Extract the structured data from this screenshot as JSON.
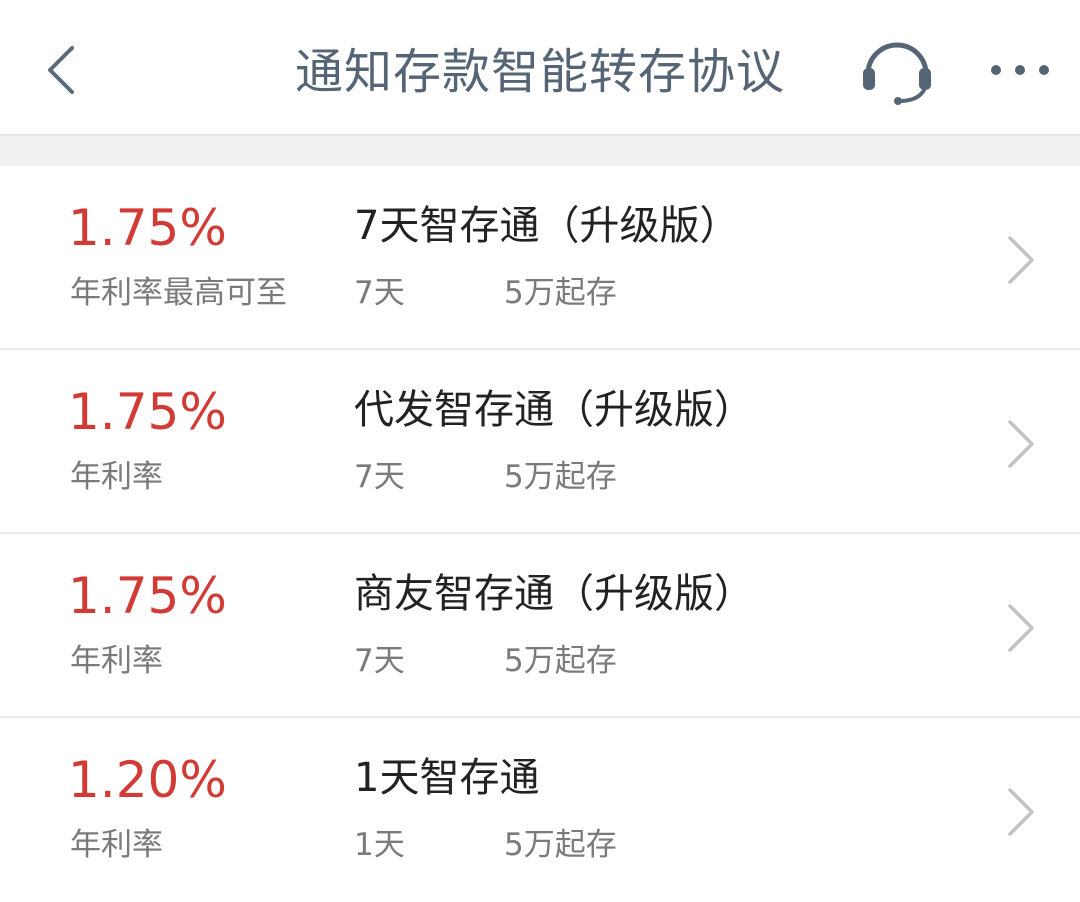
{
  "nav": {
    "title": "通知存款智能转存协议",
    "back_icon": "chevron-left-icon",
    "service_icon": "headset-icon",
    "more_icon": "more-dots-icon"
  },
  "colors": {
    "rate_red": "#d13a35",
    "title_gray": "#566576",
    "secondary_gray": "#7a7a7a"
  },
  "products": [
    {
      "rate": "1.75%",
      "rate_label": "年利率最高可至",
      "name": "7天智存通（升级版）",
      "term": "7天",
      "min_amount": "5万起存"
    },
    {
      "rate": "1.75%",
      "rate_label": "年利率",
      "name": "代发智存通（升级版）",
      "term": "7天",
      "min_amount": "5万起存"
    },
    {
      "rate": "1.75%",
      "rate_label": "年利率",
      "name": "商友智存通（升级版）",
      "term": "7天",
      "min_amount": "5万起存"
    },
    {
      "rate": "1.20%",
      "rate_label": "年利率",
      "name": "1天智存通",
      "term": "1天",
      "min_amount": "5万起存"
    }
  ]
}
